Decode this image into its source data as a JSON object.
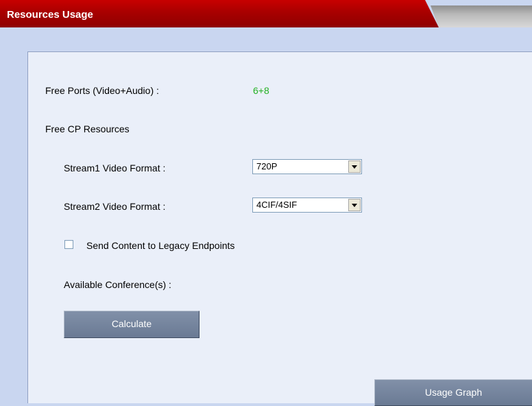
{
  "window": {
    "title": "Resources Usage"
  },
  "free_ports": {
    "label": "Free Ports (Video+Audio) :",
    "value": "6+8",
    "value_color": "#25b125"
  },
  "free_cp": {
    "label": "Free CP Resources"
  },
  "stream1": {
    "label": "Stream1 Video Format :",
    "selected": "720P"
  },
  "stream2": {
    "label": "Stream2 Video Format :",
    "selected": "4CIF/4SIF"
  },
  "send_content": {
    "label": "Send Content to Legacy Endpoints",
    "checked": false
  },
  "available": {
    "label": "Available Conference(s) :"
  },
  "buttons": {
    "calculate": "Calculate",
    "usage_graph": "Usage Graph"
  },
  "colors": {
    "title_bar": "#a80000",
    "background": "#c9d6f0",
    "panel": "#eaeff9",
    "button": "#6a7a94"
  }
}
